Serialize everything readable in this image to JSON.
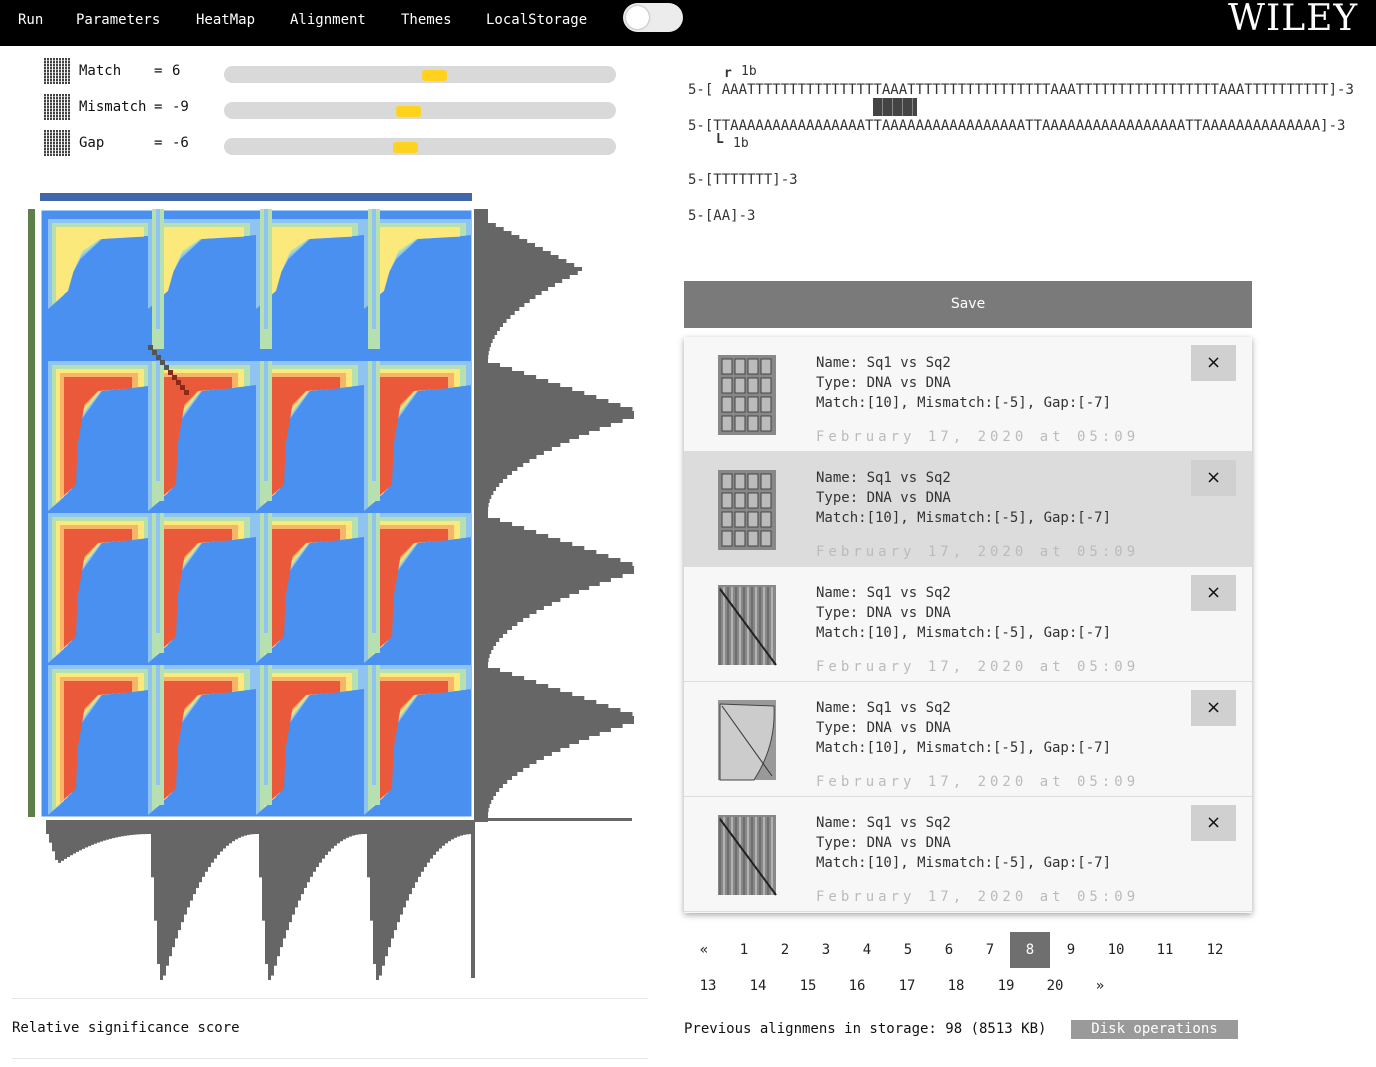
{
  "menu": {
    "run": "Run",
    "parameters": "Parameters",
    "heatmap": "HeatMap",
    "alignment": "Alignment",
    "themes": "Themes",
    "localstorage": "LocalStorage"
  },
  "brand": "WILEY",
  "params": [
    {
      "label": "Match",
      "eq": "=",
      "value": "6",
      "slider_fraction": 0.54
    },
    {
      "label": "Mismatch",
      "eq": "=",
      "value": "-9",
      "slider_fraction": 0.47
    },
    {
      "label": "Gap",
      "eq": "=",
      "value": "-6",
      "slider_fraction": 0.46
    }
  ],
  "alignment": {
    "top_marker": "r",
    "top_marker_label": "1b",
    "seq1": "5-[ AAATTTTTTTTTTTTTTTTAAATTTTTTTTTTTTTTTTTAAATTTTTTTTTTTTTTTTTAAATTTTTTTTTT]-3",
    "seq2": "5-[TTAAAAAAAAAAAAAAAATTAAAAAAAAAAAAAAAAATTAAAAAAAAAAAAAAAAATTAAAAAAAAAAAAAA]-3",
    "bottom_marker": "L",
    "bottom_marker_label": "1b",
    "seq3": "5-[TTTTTTT]-3",
    "seq4": "5-[AA]-3"
  },
  "save_label": "Save",
  "saved_items": [
    {
      "name": "Name: Sq1 vs Sq2",
      "type": "Type: DNA vs DNA",
      "params": "Match:[10], Mismatch:[-5], Gap:[-7]",
      "date": "February 17, 2020 at 05:09",
      "close": "×"
    },
    {
      "name": "Name: Sq1 vs Sq2",
      "type": "Type: DNA vs DNA",
      "params": "Match:[10], Mismatch:[-5], Gap:[-7]",
      "date": "February 17, 2020 at 05:09",
      "close": "×"
    },
    {
      "name": "Name: Sq1 vs Sq2",
      "type": "Type: DNA vs DNA",
      "params": "Match:[10], Mismatch:[-5], Gap:[-7]",
      "date": "February 17, 2020 at 05:09",
      "close": "×"
    },
    {
      "name": "Name: Sq1 vs Sq2",
      "type": "Type: DNA vs DNA",
      "params": "Match:[10], Mismatch:[-5], Gap:[-7]",
      "date": "February 17, 2020 at 05:09",
      "close": "×"
    },
    {
      "name": "Name: Sq1 vs Sq2",
      "type": "Type: DNA vs DNA",
      "params": "Match:[10], Mismatch:[-5], Gap:[-7]",
      "date": "February 17, 2020 at 05:09",
      "close": "×"
    }
  ],
  "selected_item_index": 1,
  "pagination": {
    "row1": [
      "«",
      "1",
      "2",
      "3",
      "4",
      "5",
      "6",
      "7",
      "8",
      "9",
      "10",
      "11",
      "12"
    ],
    "row2": [
      "13",
      "14",
      "15",
      "16",
      "17",
      "18",
      "19",
      "20",
      "»"
    ],
    "active": "8"
  },
  "relative_significance": "Relative significance score",
  "storage_text": "Previous alignmens in storage: 98 (8513 KB)",
  "disk_button": "Disk operations",
  "colors": {
    "heat_blue": "#4a90f0",
    "heat_lightblue": "#8fc3f0",
    "heat_green": "#b7e0b0",
    "heat_yellow": "#fbe97c",
    "heat_orange": "#f8b56a",
    "heat_red": "#ea5a3a",
    "histogram": "#666666",
    "slider_thumb": "#ffd21f"
  }
}
